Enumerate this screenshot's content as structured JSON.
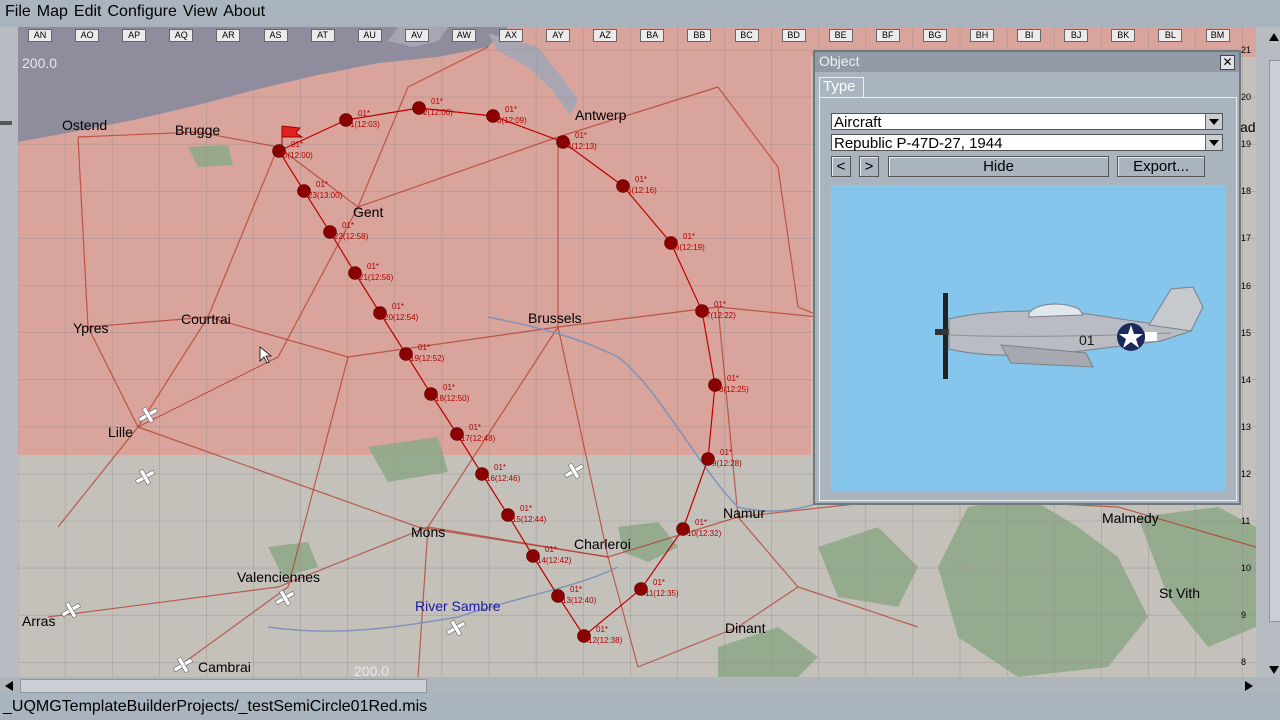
{
  "menu": [
    "File",
    "Map",
    "Edit",
    "Configure",
    "View",
    "About"
  ],
  "status": "_UQMGTemplateBuilderProjects/_testSemiCircle01Red.mis",
  "map": {
    "grid_columns": [
      "AN",
      "AO",
      "AP",
      "AQ",
      "AR",
      "AS",
      "AT",
      "AU",
      "AV",
      "AW",
      "AX",
      "AY",
      "AZ",
      "BA",
      "BB",
      "BC",
      "BD",
      "BE",
      "BF",
      "BG",
      "BH",
      "BI",
      "BJ",
      "BK",
      "BL",
      "BM"
    ],
    "grid_rows": [
      "21",
      "20",
      "19",
      "18",
      "17",
      "16",
      "15",
      "14",
      "13",
      "12",
      "11",
      "10",
      "9",
      "8"
    ],
    "altitude_label_top": "200.0",
    "altitude_label_bottom": "200.0",
    "cities": [
      "Ostend",
      "Brugge",
      "Gent",
      "Antwerp",
      "Ypres",
      "Courtrai",
      "Brussels",
      "Lille",
      "Mons",
      "Charleroi",
      "Namur",
      "Valenciennes",
      "Arras",
      "Cambrai",
      "Dinant",
      "Malmedy",
      "St Vith"
    ],
    "river_label": "River Sambre",
    "right_edge_label": "ad",
    "waypoints": [
      {
        "label": "01*",
        "time": "0(12:00)"
      },
      {
        "label": "01*",
        "time": "1(12:03)"
      },
      {
        "label": "01*",
        "time": "2(12:06)"
      },
      {
        "label": "01*",
        "time": "3(12:09)"
      },
      {
        "label": "01*",
        "time": "4(12:13)"
      },
      {
        "label": "01*",
        "time": "5(12:16)"
      },
      {
        "label": "01*",
        "time": "6(12:19)"
      },
      {
        "label": "01*",
        "time": "7(12:22)"
      },
      {
        "label": "01*",
        "time": "8(12:25)"
      },
      {
        "label": "01*",
        "time": "9(12:28)"
      },
      {
        "label": "01*",
        "time": "10(12:32)"
      },
      {
        "label": "01*",
        "time": "11(12:35)"
      },
      {
        "label": "01*",
        "time": "12(12:38)"
      },
      {
        "label": "01*",
        "time": "13(12:40)"
      },
      {
        "label": "01*",
        "time": "14(12:42)"
      },
      {
        "label": "01*",
        "time": "15(12:44)"
      },
      {
        "label": "01*",
        "time": "16(12:46)"
      },
      {
        "label": "01*",
        "time": "17(12:48)"
      },
      {
        "label": "01*",
        "time": "18(12:50)"
      },
      {
        "label": "01*",
        "time": "19(12:52)"
      },
      {
        "label": "01*",
        "time": "20(12:54)"
      },
      {
        "label": "01*",
        "time": "21(12:56)"
      },
      {
        "label": "01*",
        "time": "22(12:58)"
      },
      {
        "label": "01*",
        "time": "23(13:00)"
      }
    ]
  },
  "dialog": {
    "title": "Object",
    "close_glyph": "✕",
    "tab_label": "Type",
    "category_value": "Aircraft",
    "model_value": "Republic P-47D-27, 1944",
    "prev_label": "<",
    "next_label": ">",
    "hide_label": "Hide",
    "export_label": "Export...",
    "aircraft_code": "01"
  },
  "colors": {
    "red_territory": "#d9a49b",
    "neutral_territory": "#c4c1bb",
    "waypoint": "#8b0000",
    "route_line": "#c00000",
    "sea": "#8e8c9d",
    "forest": "#8fa98a",
    "preview_sky": "#87c6ec"
  }
}
